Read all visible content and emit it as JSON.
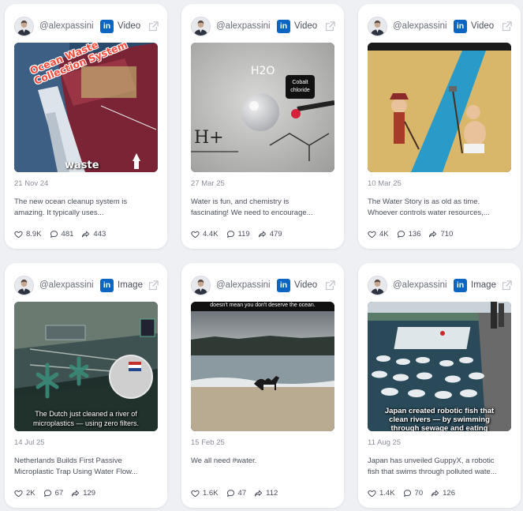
{
  "cards": [
    {
      "user": "@alexpassini",
      "kind": "Video",
      "date": "21 Nov 24",
      "desc1": "The new ocean cleanup system is",
      "desc2": "amazing. It typically uses...",
      "likes": "8.9K",
      "comments": "481",
      "shares": "443",
      "overlay_top1": "Ocean Waste",
      "overlay_top2": "Collection System",
      "overlay_bottom": "waste"
    },
    {
      "user": "@alexpassini",
      "kind": "Video",
      "date": "27 Mar 25",
      "desc1": "Water is fun, and chemistry is",
      "desc2": "fascinating! We need to encourage...",
      "likes": "4.4K",
      "comments": "119",
      "shares": "479",
      "overlay_formula": "H2O",
      "overlay_tag1": "Cobalt",
      "overlay_tag2": "chloride",
      "overlay_h": "H+"
    },
    {
      "user": "@alexpassini",
      "kind": "Video",
      "date": "10 Mar 25",
      "desc1": "The Water Story is as old as time.",
      "desc2": "Whoever controls water resources,...",
      "likes": "4K",
      "comments": "136",
      "shares": "710"
    },
    {
      "user": "@alexpassini",
      "kind": "Image",
      "date": "14 Jul 25",
      "desc1": "Netherlands Builds First Passive",
      "desc2": "Microplastic Trap Using Water Flow...",
      "likes": "2K",
      "comments": "67",
      "shares": "129",
      "overlay_cap1": "The Dutch just cleaned a river of",
      "overlay_cap2": "microplastics — using zero filters."
    },
    {
      "user": "@alexpassini",
      "kind": "Video",
      "date": "15 Feb 25",
      "desc1": "We all need #water.",
      "desc2": "",
      "likes": "1.6K",
      "comments": "47",
      "shares": "112",
      "overlay_top": "doesn't mean you don't deserve the ocean."
    },
    {
      "user": "@alexpassini",
      "kind": "Image",
      "date": "11 Aug 25",
      "desc1": "Japan has unveiled GuppyX, a robotic",
      "desc2": "fish that swims through polluted wate...",
      "likes": "1.4K",
      "comments": "70",
      "shares": "126",
      "overlay_cap1": "Japan created robotic fish that",
      "overlay_cap2": "clean rivers — by swimming",
      "overlay_cap3": "through sewage and eating"
    }
  ],
  "icons": {
    "like": "heart-icon",
    "comment": "comment-bubble-icon",
    "share": "share-arrow-icon",
    "linkedin": "linkedin-icon",
    "external": "external-link-icon"
  },
  "colors": {
    "linkedin": "#0a66c2",
    "background": "#eef0f4",
    "card": "#ffffff"
  },
  "brand_letters": "in"
}
